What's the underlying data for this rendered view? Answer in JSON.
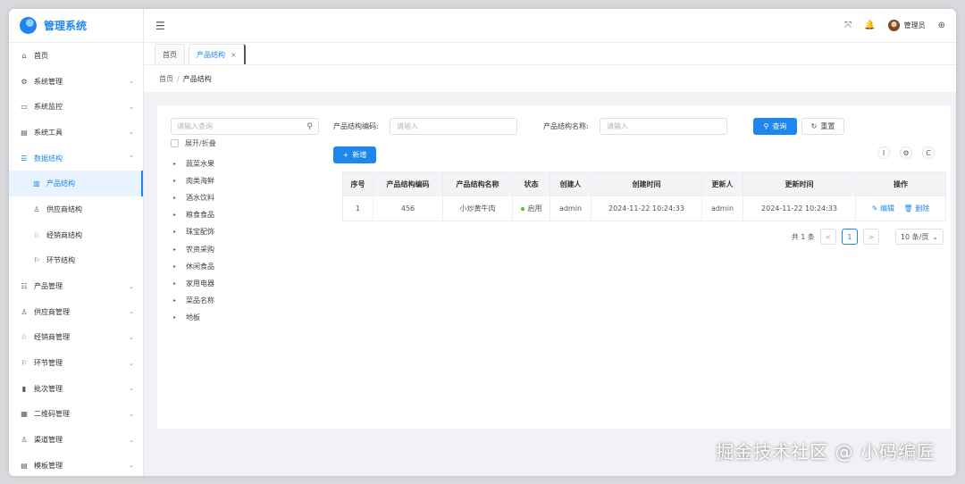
{
  "app": {
    "title": "管理系统"
  },
  "sidebar": {
    "items": [
      {
        "label": "首页",
        "icon": "⌂",
        "arrow": ""
      },
      {
        "label": "系统管理",
        "icon": "⚙",
        "arrow": "⌄"
      },
      {
        "label": "系统监控",
        "icon": "▭",
        "arrow": "⌄"
      },
      {
        "label": "系统工具",
        "icon": "▤",
        "arrow": "⌄"
      },
      {
        "label": "数据结构",
        "icon": "☰",
        "arrow": "⌃"
      },
      {
        "label": "产品结构",
        "icon": "▥",
        "arrow": ""
      },
      {
        "label": "供应商结构",
        "icon": "♙",
        "arrow": ""
      },
      {
        "label": "经销商结构",
        "icon": "♘",
        "arrow": ""
      },
      {
        "label": "环节结构",
        "icon": "⚐",
        "arrow": ""
      },
      {
        "label": "产品管理",
        "icon": "☷",
        "arrow": "⌄"
      },
      {
        "label": "供应商管理",
        "icon": "♙",
        "arrow": "⌄"
      },
      {
        "label": "经销商管理",
        "icon": "♘",
        "arrow": "⌄"
      },
      {
        "label": "环节管理",
        "icon": "⚐",
        "arrow": "⌄"
      },
      {
        "label": "批次管理",
        "icon": "▮",
        "arrow": "⌄"
      },
      {
        "label": "二维码管理",
        "icon": "▦",
        "arrow": "⌄"
      },
      {
        "label": "渠道管理",
        "icon": "♙",
        "arrow": "⌄"
      },
      {
        "label": "模板管理",
        "icon": "▤",
        "arrow": "⌄"
      }
    ]
  },
  "header": {
    "fold_icon": "☰",
    "fullscreen_icon": "⤧",
    "bell_icon": "🔔",
    "user_name": "管理员",
    "lang_icon": "⊕"
  },
  "tabs": [
    {
      "label": "首页"
    },
    {
      "label": "产品结构",
      "close": "×"
    }
  ],
  "breadcrumb": {
    "home": "首页",
    "sep": "/",
    "current": "产品结构"
  },
  "tree": {
    "search_placeholder": "请输入查询",
    "search_icon": "⚲",
    "toggle_label": "展开/折叠",
    "caret": "▸",
    "nodes": [
      "蔬菜水果",
      "肉类海鲜",
      "酒水饮料",
      "粮食食品",
      "珠宝配饰",
      "农资采购",
      "休闲食品",
      "家用电器",
      "菜品名称",
      "地板"
    ]
  },
  "filters": {
    "code_label": "产品结构编码:",
    "code_placeholder": "请输入",
    "name_label": "产品结构名称:",
    "name_placeholder": "请输入",
    "search_btn": "查询",
    "search_icon": "⚲",
    "reset_btn": "重置",
    "reset_icon": "↻",
    "add_btn": "新增",
    "add_icon": "+"
  },
  "toolbar": {
    "column_icon": "I",
    "settings_icon": "⚙",
    "refresh_icon": "C"
  },
  "table": {
    "headers": [
      "序号",
      "产品结构编码",
      "产品结构名称",
      "状态",
      "创建人",
      "创建时间",
      "更新人",
      "更新时间",
      "操作"
    ],
    "rows": [
      {
        "index": "1",
        "code": "456",
        "name": "小炒黄牛肉",
        "status": "启用",
        "creator": "admin",
        "created": "2024-11-22 10:24:33",
        "updater": "admin",
        "updated": "2024-11-22 10:24:33",
        "edit": "编辑",
        "edit_icon": "✎",
        "delete": "删除",
        "delete_icon": "🗑"
      }
    ]
  },
  "pagination": {
    "total": "共 1 条",
    "prev": "<",
    "page": "1",
    "next": ">",
    "size": "10 条/页",
    "size_arrow": "⌄"
  },
  "watermark": "掘金技术社区 @ 小码编匠",
  "colors": {
    "accent": "#1f86ee",
    "status_enabled": "#52c41a"
  }
}
